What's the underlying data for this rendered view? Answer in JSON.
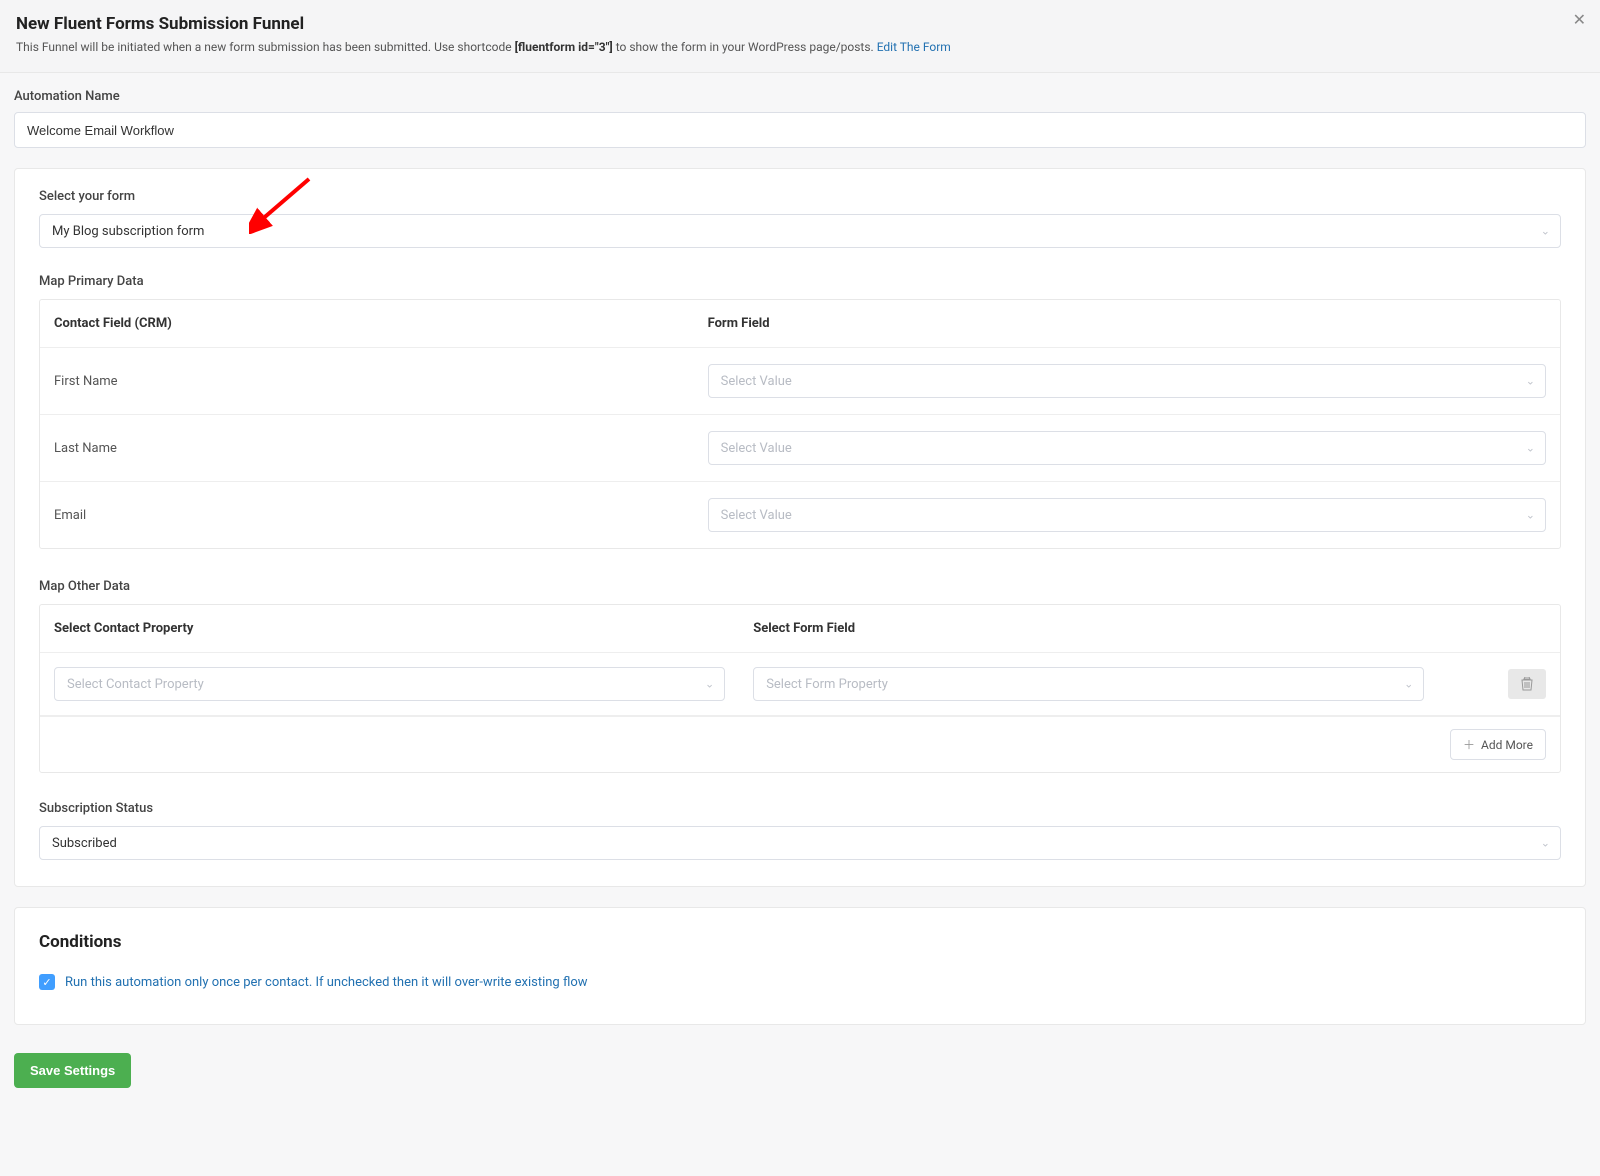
{
  "header": {
    "title": "New Fluent Forms Submission Funnel",
    "description_prefix": "This Funnel will be initiated when a new form submission has been submitted. Use shortcode ",
    "shortcode": "[fluentform id=\"3\"]",
    "description_suffix": " to show the form in your WordPress page/posts. ",
    "edit_link": "Edit The Form"
  },
  "automation_name": {
    "label": "Automation Name",
    "value": "Welcome Email Workflow"
  },
  "form_select": {
    "label": "Select your form",
    "value": "My Blog subscription form"
  },
  "map_primary": {
    "title": "Map Primary Data",
    "col1": "Contact Field (CRM)",
    "col2": "Form Field",
    "placeholder": "Select Value",
    "rows": [
      {
        "label": "First Name"
      },
      {
        "label": "Last Name"
      },
      {
        "label": "Email"
      }
    ]
  },
  "map_other": {
    "title": "Map Other Data",
    "col1": "Select Contact Property",
    "col2": "Select Form Field",
    "placeholder1": "Select Contact Property",
    "placeholder2": "Select Form Property",
    "add_more": "Add More"
  },
  "subscription_status": {
    "label": "Subscription Status",
    "value": "Subscribed"
  },
  "conditions": {
    "title": "Conditions",
    "checkbox_label": "Run this automation only once per contact. If unchecked then it will over-write existing flow",
    "checked": true
  },
  "save_button": "Save Settings"
}
